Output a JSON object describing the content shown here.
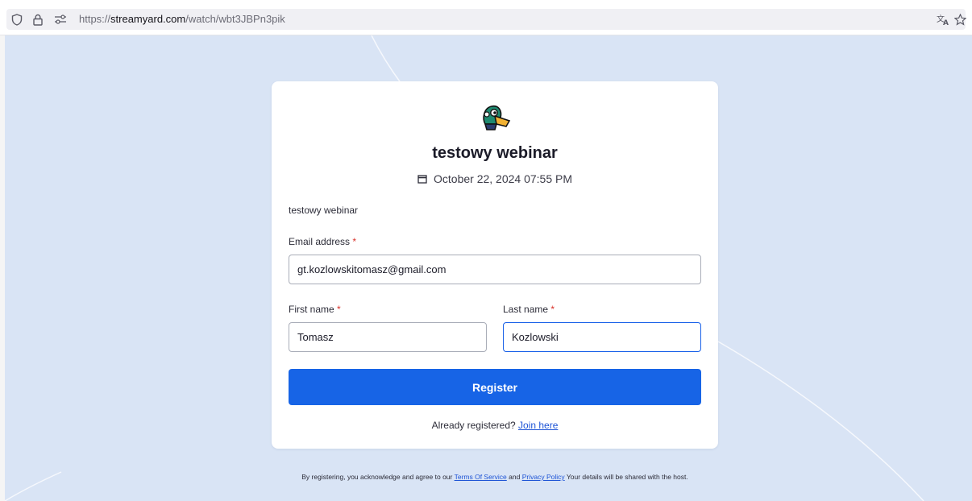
{
  "browser": {
    "url_scheme": "https://",
    "url_host": "streamyard.com",
    "url_path": "/watch/wbt3JBPn3pik",
    "icons": [
      "shield-icon",
      "lock-icon",
      "permissions-icon",
      "translate-icon",
      "bookmark-star-icon"
    ]
  },
  "event": {
    "title": "testowy webinar",
    "datetime": "October 22, 2024 07:55 PM",
    "description": "testowy webinar",
    "icons": [
      "duck-logo-icon",
      "calendar-icon"
    ]
  },
  "form": {
    "email_label": "Email address",
    "email_value": "gt.kozlowskitomasz@gmail.com",
    "first_name_label": "First name",
    "first_name_value": "Tomasz",
    "last_name_label": "Last name",
    "last_name_value": "Kozlowski",
    "required_mark": "*",
    "register_label": "Register",
    "already_text": "Already registered?",
    "join_link": "Join here"
  },
  "legal": {
    "prefix": "By registering, you acknowledge and agree to our",
    "terms_link": "Terms Of Service",
    "and": "and",
    "privacy_link": "Privacy Policy",
    "suffix": "Your details will be shared with the host."
  },
  "colors": {
    "page_background": "#d9e4f5",
    "primary_button": "#1764e6",
    "link": "#1f55d6",
    "required": "#d8322a",
    "focus_border": "#1860e8"
  }
}
